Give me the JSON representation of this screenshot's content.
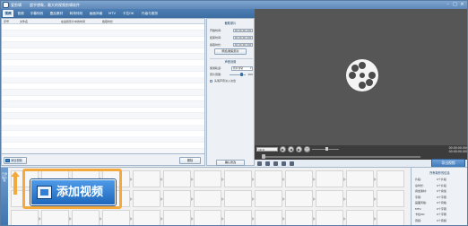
{
  "titlebar": {
    "app_name": "爱剪辑",
    "tagline": "超乎想象，最大的视频剪辑软件",
    "controls": [
      "–",
      "□",
      "×"
    ]
  },
  "menu_tabs": [
    "视频",
    "音频",
    "字幕特效",
    "叠加素材",
    "转场特效",
    "画面风格",
    "MTV",
    "卡拉OK",
    "升级与服务"
  ],
  "file_list": {
    "columns": [
      "序号",
      "文件名",
      "在最终影片中的时间",
      "截取时长"
    ],
    "row_count": 22
  },
  "left_bottom": {
    "add_video": "添加视频",
    "delete": "删除"
  },
  "settings": {
    "clip_title": "截取原片",
    "start_label": "开始时间:",
    "start_value": "00:00:00.000",
    "end_label": "结束时间:",
    "end_value": "00:00:00.000",
    "duration_label": "截取时长:",
    "duration_value": "00:00:00.000",
    "preview_cut": "预览/截取原片",
    "audio_title": "声音设置",
    "track_label": "使用轨道:",
    "track_value": "原片音轨",
    "volume_label": "原片音量:",
    "volume_value": "100",
    "volume_fraction": 0.75,
    "headset_label": "头尾声音淡入淡出",
    "clear_all": "确认修改"
  },
  "player": {
    "aspect": "16:9",
    "time_current": "00:00:00.000",
    "time_total": "00:00:00.000",
    "seek_fraction": 0.0,
    "volume_fraction": 0.55
  },
  "export_button": "导出视频",
  "timeline": {
    "side_tab": "已添加片段",
    "rows": 3,
    "cols": 13
  },
  "callout": {
    "label": "添加视频"
  },
  "info_panel": {
    "title": "所有制作的信息",
    "rows": [
      {
        "k": "片段:",
        "v": "0个片段"
      },
      {
        "k": "总时长:",
        "v": "0个片段"
      },
      {
        "k": "叠加素材:",
        "v": "0个叠加"
      },
      {
        "k": "字幕:",
        "v": "0个字幕"
      },
      {
        "k": "画面风格:",
        "v": "0个风格"
      },
      {
        "k": "MTV:",
        "v": "0个字幕"
      },
      {
        "k": "卡拉OK:",
        "v": "0个字幕"
      },
      {
        "k": "音频:",
        "v": "0个音频"
      }
    ]
  },
  "colors": {
    "accent": "#3c6da2",
    "player_bg": "#565656",
    "callout": "#f3a93b",
    "add_button": "#1e67bd"
  }
}
